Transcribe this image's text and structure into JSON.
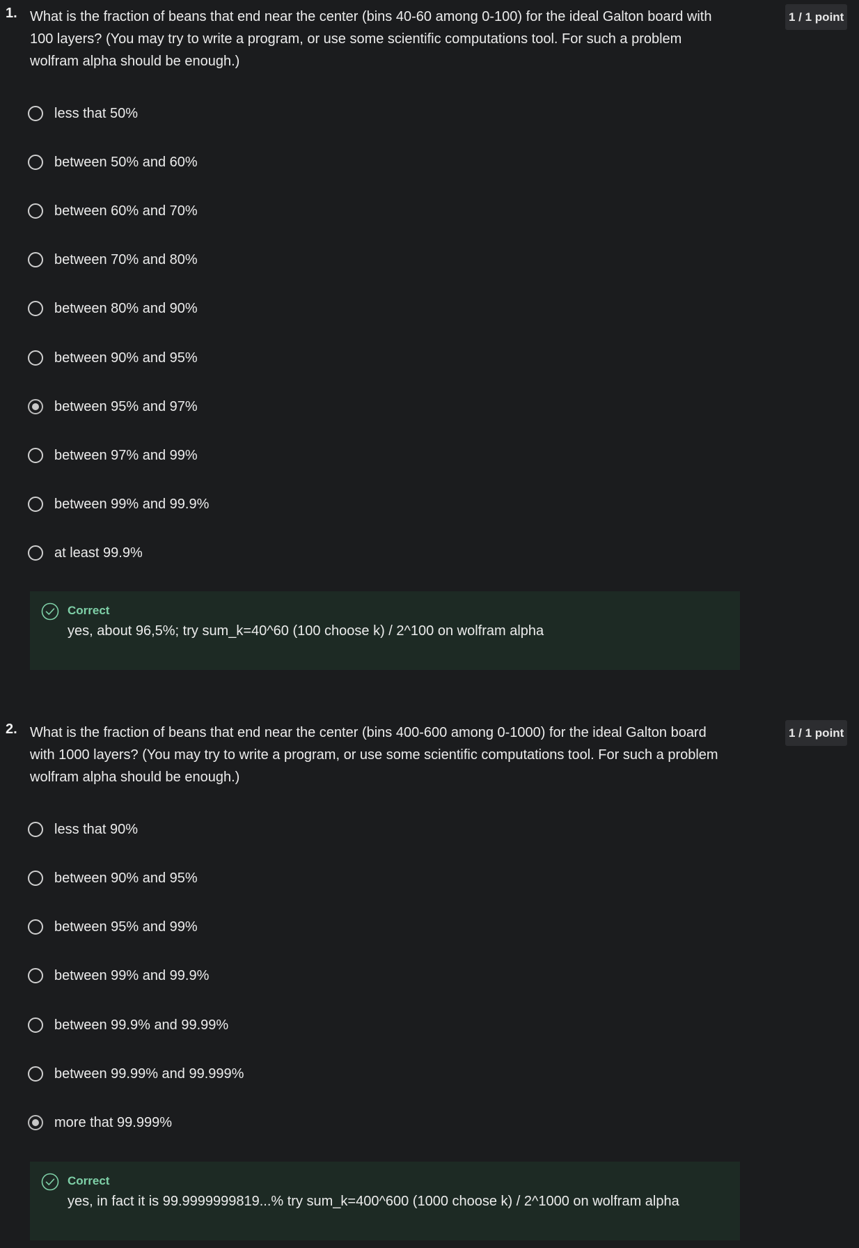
{
  "colors": {
    "background": "#1b1c1e",
    "feedback_background": "#1d2a24",
    "correct_accent": "#7fd1a8",
    "badge_background": "#2c2d30"
  },
  "questions": [
    {
      "number": "1.",
      "text": "What is the fraction of beans that end near the center (bins 40-60 among 0-100) for the ideal Galton board with 100 layers?  (You may try to write a program, or use some scientific computations tool. For such a problem wolfram alpha should be enough.)",
      "points": "1 / 1 point",
      "options": [
        {
          "label": "less that 50%",
          "selected": false
        },
        {
          "label": "between 50% and 60%",
          "selected": false
        },
        {
          "label": "between 60% and 70%",
          "selected": false
        },
        {
          "label": "between 70% and 80%",
          "selected": false
        },
        {
          "label": "between 80% and 90%",
          "selected": false
        },
        {
          "label": "between 90% and 95%",
          "selected": false
        },
        {
          "label": "between 95% and 97%",
          "selected": true
        },
        {
          "label": "between 97% and 99%",
          "selected": false
        },
        {
          "label": "between 99% and 99.9%",
          "selected": false
        },
        {
          "label": "at least 99.9%",
          "selected": false
        }
      ],
      "feedback": {
        "icon": "check-circle-icon",
        "status": "Correct",
        "text": "yes, about 96,5%; try sum_k=40^60 (100 choose k) / 2^100 on wolfram alpha"
      }
    },
    {
      "number": "2.",
      "text": "What is the fraction of beans that end near the center (bins 400-600 among 0-1000) for the ideal Galton board with 1000 layers?  (You may try to write a program, or use some scientific computations tool. For such a problem wolfram alpha should be enough.)",
      "points": "1 / 1 point",
      "options": [
        {
          "label": "less that 90%",
          "selected": false
        },
        {
          "label": "between 90% and 95%",
          "selected": false
        },
        {
          "label": "between 95% and 99%",
          "selected": false
        },
        {
          "label": "between 99% and 99.9%",
          "selected": false
        },
        {
          "label": "between 99.9% and 99.99%",
          "selected": false
        },
        {
          "label": "between 99.99% and 99.999%",
          "selected": false
        },
        {
          "label": "more that 99.999%",
          "selected": true
        }
      ],
      "feedback": {
        "icon": "check-circle-icon",
        "status": "Correct",
        "text": "yes, in fact it is 99.9999999819...% try sum_k=400^600 (1000 choose k) / 2^1000 on wolfram alpha"
      }
    }
  ]
}
